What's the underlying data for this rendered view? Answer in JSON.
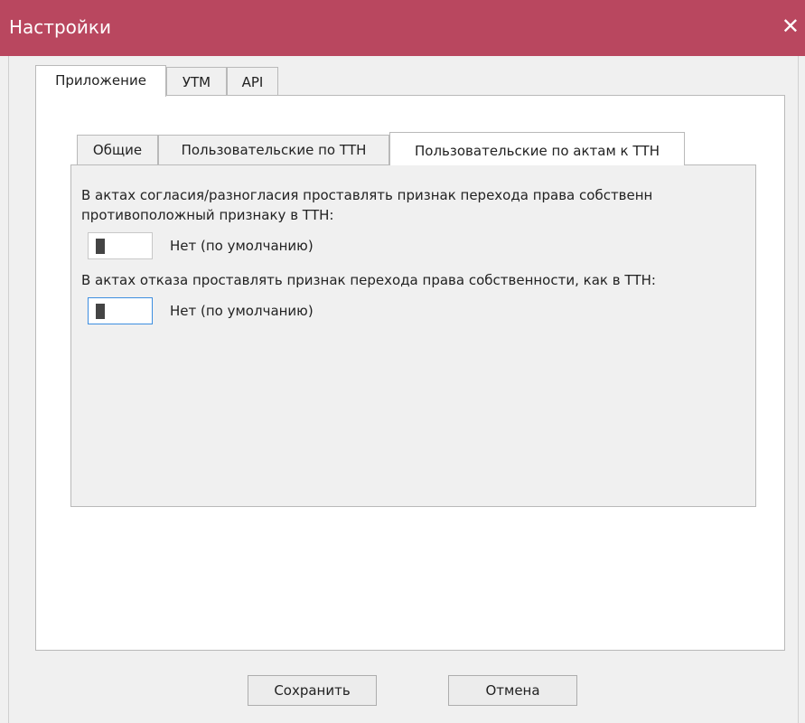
{
  "window": {
    "title": "Настройки",
    "close_glyph": "✕"
  },
  "outer_tabs": [
    {
      "label": "Приложение",
      "active": true
    },
    {
      "label": "УТМ",
      "active": false
    },
    {
      "label": "API",
      "active": false
    }
  ],
  "inner_tabs": [
    {
      "label": "Общие",
      "active": false
    },
    {
      "label": "Пользовательские по ТТН",
      "active": false
    },
    {
      "label": "Пользовательские по актам к ТТН",
      "active": true
    }
  ],
  "settings": [
    {
      "label_line1": "В актах согласия/разногласия проставлять признак перехода права собственн",
      "label_line2": "противоположный признаку в ТТН:",
      "value": "Нет (по умолчанию)",
      "checked": false
    },
    {
      "label_line1": "В актах отказа проставлять признак перехода права собственности, как в ТТН:",
      "value": "Нет (по умолчанию)",
      "checked": false,
      "focused": true
    }
  ],
  "buttons": {
    "save": "Сохранить",
    "cancel": "Отмена"
  }
}
